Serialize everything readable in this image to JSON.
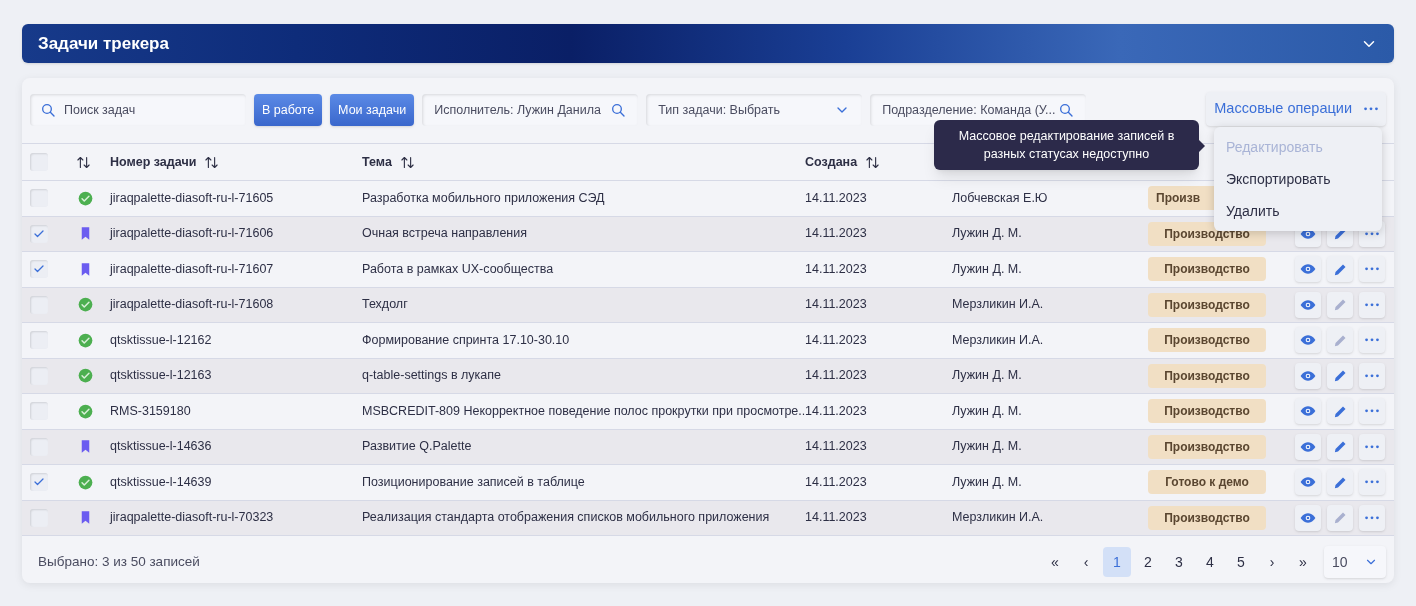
{
  "panel": {
    "title": "Задачи трекера",
    "expanded": true
  },
  "toolbar": {
    "search": {
      "placeholder": "Поиск задач"
    },
    "quick_filters": [
      {
        "label": "В работе",
        "selected": true
      },
      {
        "label": "Мои задачи",
        "selected": true
      }
    ],
    "filters": [
      {
        "kind": "search",
        "value": "Исполнитель: Лужин Данила"
      },
      {
        "kind": "select",
        "value": "Тип задачи: Выбрать"
      },
      {
        "kind": "search",
        "value": "Подразделение: Команда (У..."
      }
    ],
    "bulk_button": "Массовые операции"
  },
  "tooltip": "Массовое редактирование записей в разных статусах недоступно",
  "bulk_menu": [
    {
      "label": "Редактировать",
      "disabled": true
    },
    {
      "label": "Экспортировать",
      "disabled": false
    },
    {
      "label": "Удалить",
      "disabled": false
    }
  ],
  "table": {
    "all_checked": false,
    "columns": [
      {
        "label": "Номер задачи",
        "sortable": true
      },
      {
        "label": "Тема",
        "sortable": true
      },
      {
        "label": "Создана",
        "sortable": true
      }
    ],
    "rows": [
      {
        "checked": false,
        "kind": "done",
        "number": "jiraqpalette-diasoft-ru-l-71605",
        "theme": "Разработка мобильного приложения СЭД",
        "created": "14.11.2023",
        "assignee": "Лобчевская Е.Ю",
        "status": "Произв"
      },
      {
        "checked": true,
        "kind": "bookmark",
        "number": "jiraqpalette-diasoft-ru-l-71606",
        "theme": "Очная встреча направления",
        "created": "14.11.2023",
        "assignee": "Лужин Д. М.",
        "status": "Производство",
        "actions": {
          "edit_disabled": false
        }
      },
      {
        "checked": true,
        "kind": "bookmark",
        "number": "jiraqpalette-diasoft-ru-l-71607",
        "theme": "Работа в рамках UX-сообщества",
        "created": "14.11.2023",
        "assignee": "Лужин Д. М.",
        "status": "Производство",
        "actions": {
          "edit_disabled": false
        }
      },
      {
        "checked": false,
        "kind": "done",
        "number": "jiraqpalette-diasoft-ru-l-71608",
        "theme": "Техдолг",
        "created": "14.11.2023",
        "assignee": "Мерзликин И.А.",
        "status": "Производство",
        "actions": {
          "edit_disabled": true
        }
      },
      {
        "checked": false,
        "kind": "done",
        "number": "qtsktissue-l-12162",
        "theme": "Формирование спринта 17.10-30.10",
        "created": "14.11.2023",
        "assignee": "Мерзликин И.А.",
        "status": "Производство",
        "actions": {
          "edit_disabled": true
        }
      },
      {
        "checked": false,
        "kind": "done",
        "number": "qtsktissue-l-12163",
        "theme": "q-table-settings в лукапе",
        "created": "14.11.2023",
        "assignee": "Лужин Д. М.",
        "status": "Производство",
        "actions": {
          "edit_disabled": false
        }
      },
      {
        "checked": false,
        "kind": "done",
        "number": "RMS-3159180",
        "theme": "MSBCREDIT-809 Некорректное поведение полос прокрутки при просмотре..",
        "created": "14.11.2023",
        "assignee": "Лужин Д. М.",
        "status": "Производство",
        "actions": {
          "edit_disabled": false
        }
      },
      {
        "checked": false,
        "kind": "bookmark",
        "number": "qtsktissue-l-14636",
        "theme": "Развитие Q.Palette",
        "created": "14.11.2023",
        "assignee": "Лужин Д. М.",
        "status": "Производство",
        "actions": {
          "edit_disabled": false
        }
      },
      {
        "checked": true,
        "kind": "done",
        "number": "qtsktissue-l-14639",
        "theme": "Позиционирование записей в таблице",
        "created": "14.11.2023",
        "assignee": "Лужин Д. М.",
        "status": "Готово к демо",
        "actions": {
          "edit_disabled": false
        }
      },
      {
        "checked": false,
        "kind": "bookmark",
        "number": "jiraqpalette-diasoft-ru-l-70323",
        "theme": "Реализация стандарта отображения списков мобильного приложения",
        "created": "14.11.2023",
        "assignee": "Мерзликин И.А.",
        "status": "Производство",
        "actions": {
          "edit_disabled": true
        }
      }
    ]
  },
  "footer": {
    "selected_info": "Выбрано: 3 из 50 записей",
    "pagination": {
      "first": "«",
      "prev": "‹",
      "pages": [
        {
          "label": "1",
          "selected": true
        },
        {
          "label": "2",
          "selected": false
        },
        {
          "label": "3",
          "selected": false
        },
        {
          "label": "4",
          "selected": false
        },
        {
          "label": "5",
          "selected": false
        }
      ],
      "next": "›",
      "last": "»"
    },
    "page_size": "10"
  }
}
